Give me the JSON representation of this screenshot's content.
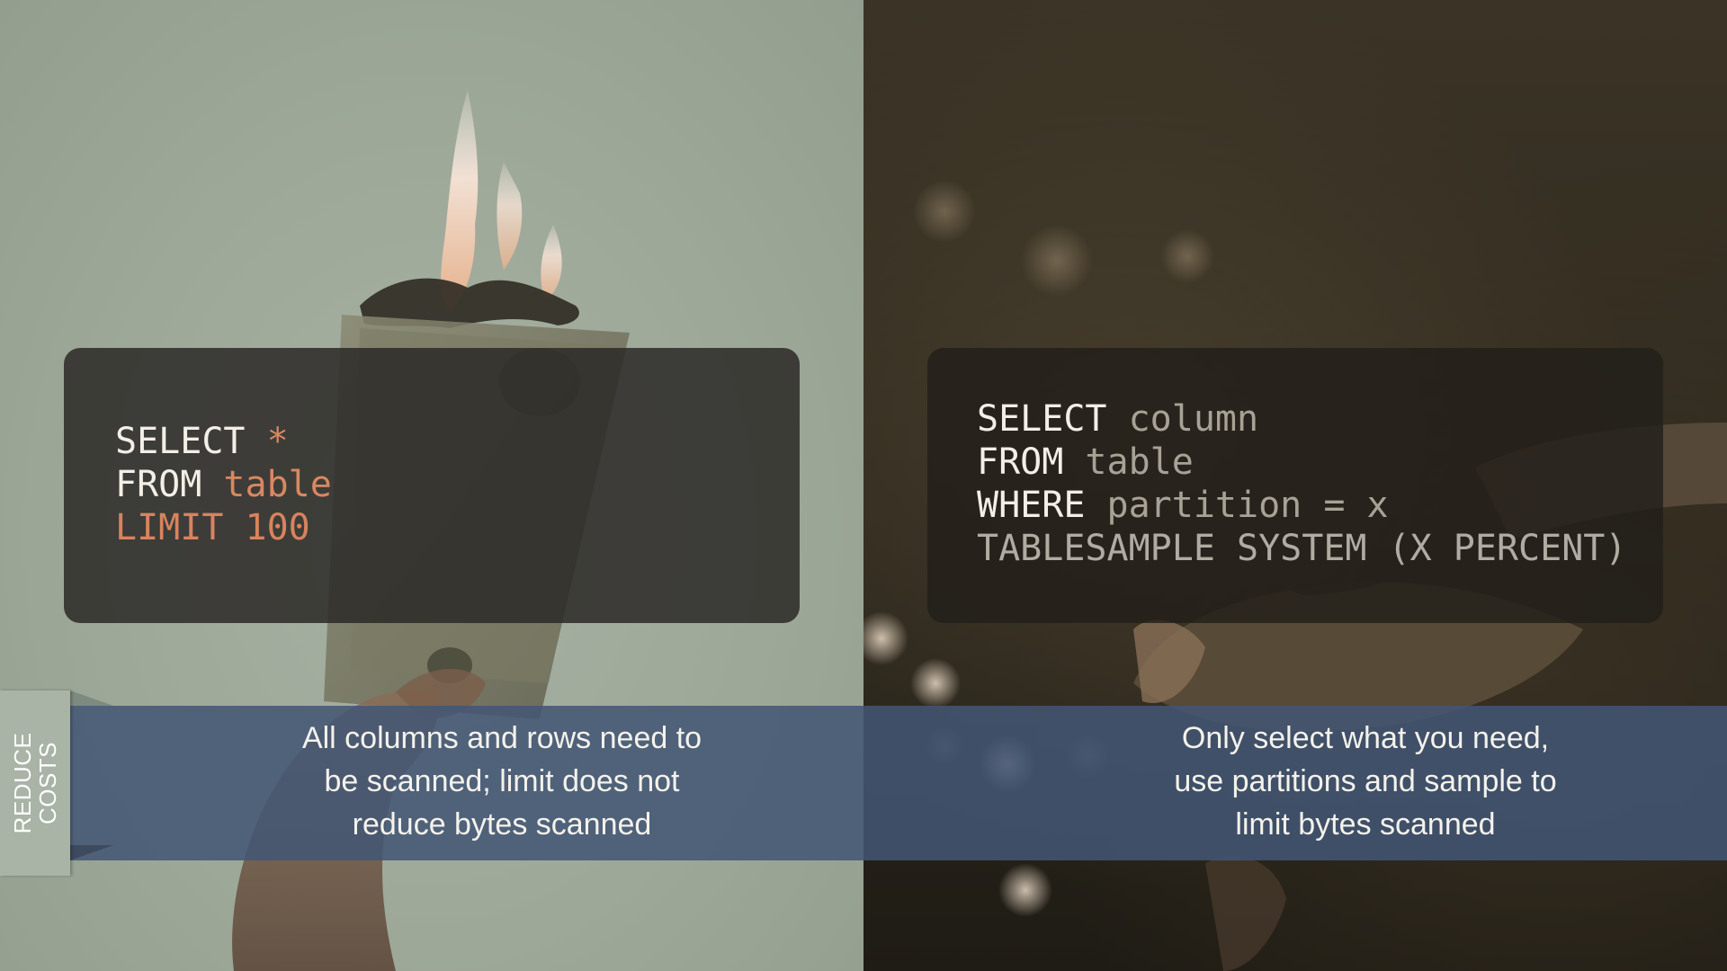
{
  "slide": {
    "side_tag": {
      "line1": "REDUCE",
      "line2": "COSTS"
    },
    "left": {
      "code": {
        "line1_keyword": "SELECT",
        "line1_arg": "*",
        "line2_keyword": "FROM",
        "line2_arg": "table",
        "line3": "LIMIT 100"
      },
      "caption": {
        "line1": "All columns and rows need to",
        "line2": "be scanned; limit does not",
        "line3": "reduce bytes scanned"
      },
      "background_image": "burning-money-photo"
    },
    "right": {
      "code": {
        "line1_keyword": "SELECT",
        "line1_arg": "column",
        "line2_keyword": "FROM",
        "line2_arg": "table",
        "line3_keyword": "WHERE",
        "line3_arg": "partition = x",
        "line4": "TABLESAMPLE SYSTEM (X PERCENT)"
      },
      "caption": {
        "line1": "Only select what you need,",
        "line2": "use partitions and sample to",
        "line3": "limit bytes scanned"
      },
      "background_image": "hands-holding-soil-photo"
    },
    "colors": {
      "left_background": "#9da898",
      "right_background": "#2f2a1f",
      "code_box": "#2c2a28",
      "keyword": "#f3efe6",
      "accent_orange": "#d88862",
      "muted_text": "#a8a296",
      "caption_band": "#425674",
      "side_tag": "#a9b3a6"
    }
  }
}
